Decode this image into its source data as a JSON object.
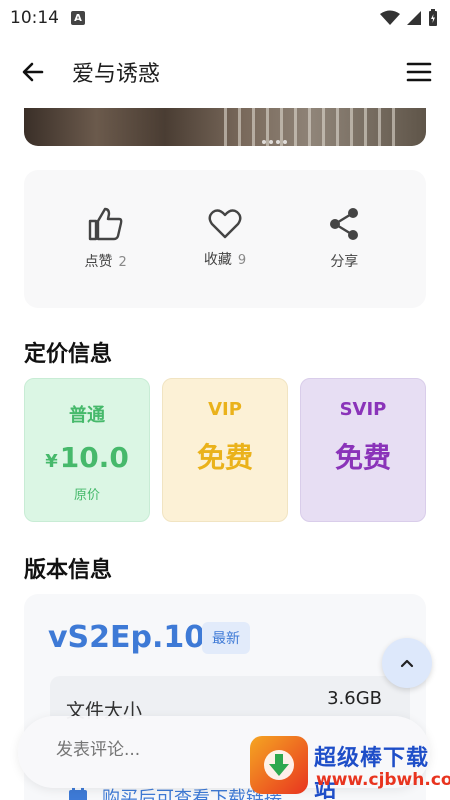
{
  "status_bar": {
    "time": "10:14",
    "badge": "A"
  },
  "app_bar": {
    "title": "爱与诱惑"
  },
  "actions": {
    "like_label": "点赞",
    "like_count": "2",
    "fav_label": "收藏",
    "fav_count": "9",
    "share_label": "分享"
  },
  "pricing": {
    "title": "定价信息",
    "normal": {
      "tier": "普通",
      "currency": "¥",
      "value": "10.0",
      "sub": "原价"
    },
    "vip": {
      "tier": "VIP",
      "value": "免费"
    },
    "svip": {
      "tier": "SVIP",
      "value": "免费"
    }
  },
  "version": {
    "title": "版本信息",
    "name": "vS2Ep.10",
    "badge": "最新",
    "file_size_label": "文件大小",
    "file_size": "3.6GB",
    "buy_hint": "购买后可查看下载链接"
  },
  "comment": {
    "placeholder": "发表评论..."
  },
  "watermark": {
    "title": "超级棒下载站",
    "url": "www.cjbwh.com"
  },
  "colors": {
    "accent": "#3e7ad6",
    "normal": "#46b96b",
    "vip": "#eab21b",
    "svip": "#8a33b9"
  }
}
